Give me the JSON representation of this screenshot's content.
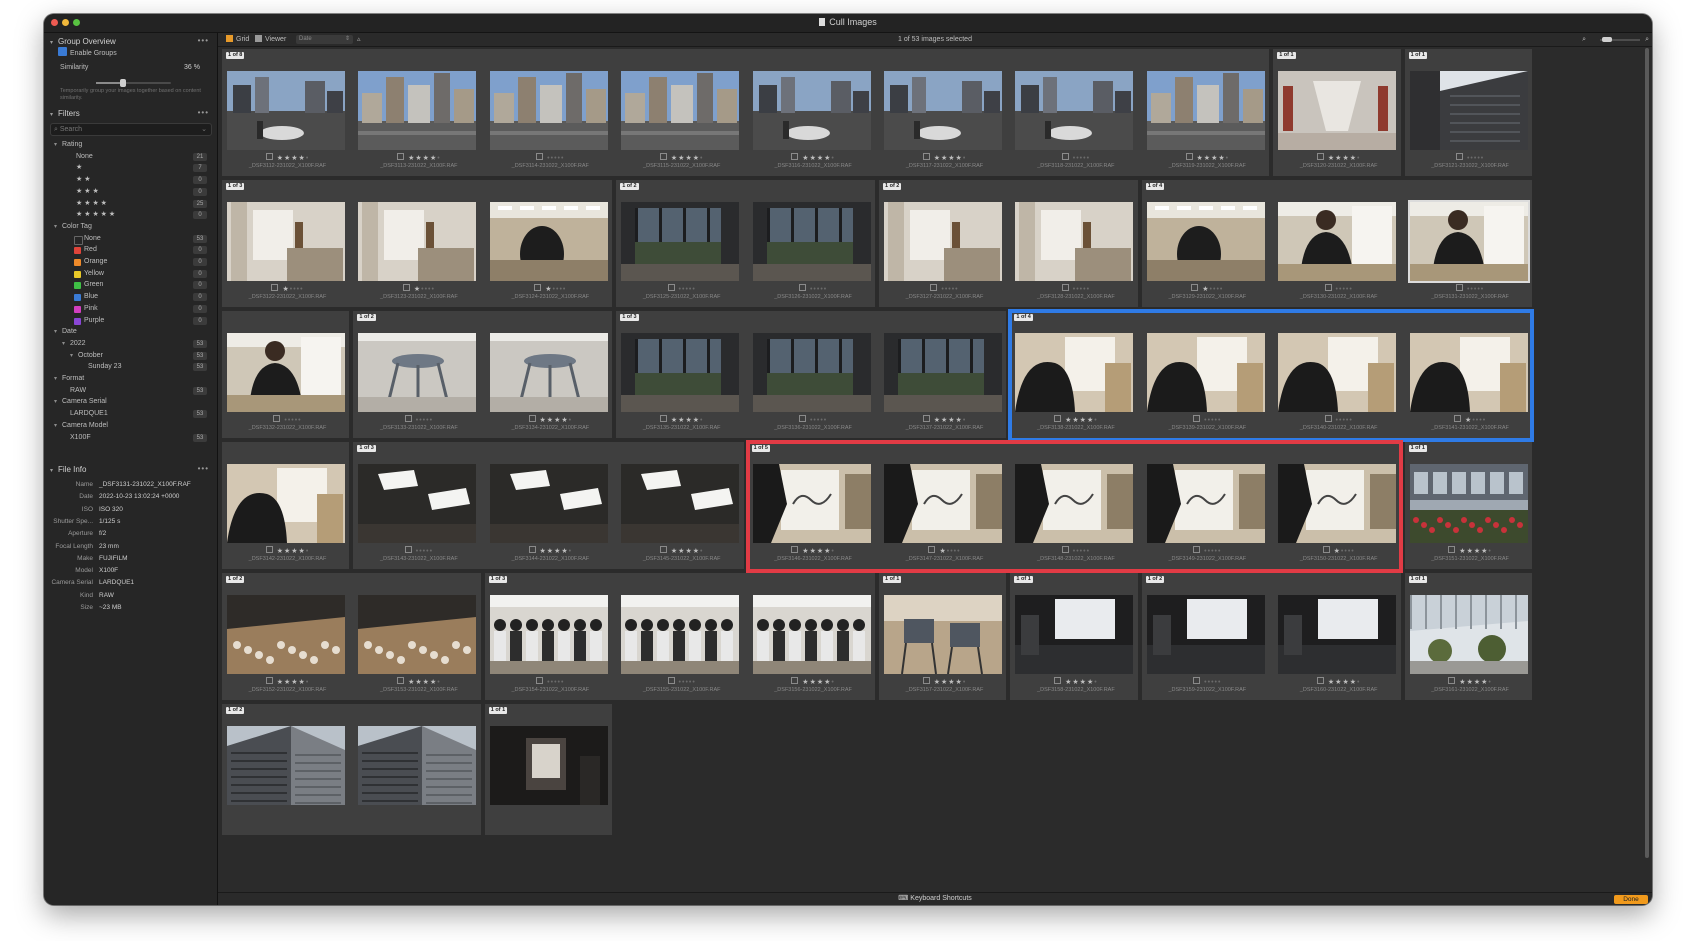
{
  "window": {
    "title": "Cull Images"
  },
  "sidebar": {
    "group_overview": {
      "title": "Group Overview",
      "enable_label": "Enable Groups",
      "similarity_label": "Similarity",
      "similarity_value": "36 %",
      "similarity_fraction": 0.36,
      "hint": "Temporarily group your images together based on content similarity."
    },
    "filters": {
      "title": "Filters",
      "search_placeholder": "Search",
      "rating": {
        "title": "Rating",
        "rows": [
          {
            "label": "None",
            "count": "21"
          },
          {
            "label": "★",
            "count": "7"
          },
          {
            "label": "★ ★",
            "count": "0"
          },
          {
            "label": "★ ★ ★",
            "count": "0"
          },
          {
            "label": "★ ★ ★ ★",
            "count": "25"
          },
          {
            "label": "★ ★ ★ ★ ★",
            "count": "0"
          }
        ]
      },
      "color_tag": {
        "title": "Color Tag",
        "rows": [
          {
            "label": "None",
            "count": "53",
            "color": "#262626"
          },
          {
            "label": "Red",
            "count": "0",
            "color": "#e0443a"
          },
          {
            "label": "Orange",
            "count": "0",
            "color": "#ef8a2a"
          },
          {
            "label": "Yellow",
            "count": "0",
            "color": "#e9c928"
          },
          {
            "label": "Green",
            "count": "0",
            "color": "#3fbf45"
          },
          {
            "label": "Blue",
            "count": "0",
            "color": "#3a7bd5"
          },
          {
            "label": "Pink",
            "count": "0",
            "color": "#d13fc0"
          },
          {
            "label": "Purple",
            "count": "0",
            "color": "#8a46d6"
          }
        ]
      },
      "date": {
        "title": "Date",
        "year": "2022",
        "year_count": "53",
        "month": "October",
        "month_count": "53",
        "day": "Sunday 23",
        "day_count": "53"
      },
      "format": {
        "title": "Format",
        "value": "RAW",
        "count": "53"
      },
      "camera_serial": {
        "title": "Camera Serial",
        "value": "LARDQUE1",
        "count": "53"
      },
      "camera_model": {
        "title": "Camera Model",
        "value": "X100F",
        "count": "53"
      }
    },
    "file_info": {
      "title": "File Info",
      "fields": [
        {
          "key": "Name",
          "value": "_DSF3131-231022_X100F.RAF"
        },
        {
          "key": "Date",
          "value": "2022-10-23 13:02:24 +0000"
        },
        {
          "key": "ISO",
          "value": "ISO 320"
        },
        {
          "key": "Shutter Spe...",
          "value": "1/125 s"
        },
        {
          "key": "Aperture",
          "value": "f/2"
        },
        {
          "key": "Focal Length",
          "value": "23 mm"
        },
        {
          "key": "Make",
          "value": "FUJIFILM"
        },
        {
          "key": "Model",
          "value": "X100F"
        },
        {
          "key": "Camera Serial",
          "value": "LARDQUE1"
        },
        {
          "key": "Kind",
          "value": "RAW"
        },
        {
          "key": "Size",
          "value": "~23 MB"
        }
      ]
    }
  },
  "toolbar": {
    "grid_label": "Grid",
    "viewer_label": "Viewer",
    "sort_value": "Date",
    "selection_status": "1 of 53 images selected"
  },
  "grid": {
    "groups": [
      {
        "badge": "1 of 8",
        "row": 0,
        "start": 0,
        "count": 8
      },
      {
        "badge": "1 of 1",
        "row": 0,
        "start": 8,
        "count": 1
      },
      {
        "badge": "1 of 1",
        "row": 0,
        "start": 9,
        "count": 1
      },
      {
        "badge": "1 of 3",
        "row": 1,
        "start": 0,
        "count": 3
      },
      {
        "badge": "1 of 2",
        "row": 1,
        "start": 3,
        "count": 2
      },
      {
        "badge": "1 of 2",
        "row": 1,
        "start": 5,
        "count": 2
      },
      {
        "badge": "1 of 4",
        "row": 1,
        "start": 7,
        "count": 3
      },
      {
        "badge": "",
        "row": 2,
        "start": 0,
        "count": 1
      },
      {
        "badge": "1 of 2",
        "row": 2,
        "start": 1,
        "count": 2
      },
      {
        "badge": "1 of 3",
        "row": 2,
        "start": 3,
        "count": 3
      },
      {
        "badge": "1 of 4",
        "row": 2,
        "start": 6,
        "count": 4
      },
      {
        "badge": "",
        "row": 3,
        "start": 0,
        "count": 1
      },
      {
        "badge": "1 of 3",
        "row": 3,
        "start": 1,
        "count": 3
      },
      {
        "badge": "1 of 5",
        "row": 3,
        "start": 4,
        "count": 5
      },
      {
        "badge": "1 of 1",
        "row": 3,
        "start": 9,
        "count": 1
      },
      {
        "badge": "1 of 2",
        "row": 4,
        "start": 0,
        "count": 2
      },
      {
        "badge": "1 of 3",
        "row": 4,
        "start": 2,
        "count": 3
      },
      {
        "badge": "1 of 1",
        "row": 4,
        "start": 5,
        "count": 1
      },
      {
        "badge": "1 of 1",
        "row": 4,
        "start": 6,
        "count": 1
      },
      {
        "badge": "1 of 2",
        "row": 4,
        "start": 7,
        "count": 2
      },
      {
        "badge": "1 of 1",
        "row": 4,
        "start": 9,
        "count": 1
      },
      {
        "badge": "1 of 2",
        "row": 5,
        "start": 0,
        "count": 2
      },
      {
        "badge": "1 of 1",
        "row": 5,
        "start": 2,
        "count": 1
      }
    ],
    "images": [
      {
        "row": 0,
        "col": 0,
        "name": "_DSF3112-231022_X100F.RAF",
        "rating": 4,
        "scene": "street"
      },
      {
        "row": 0,
        "col": 1,
        "name": "_DSF3113-231022_X100F.RAF",
        "rating": 4,
        "scene": "city"
      },
      {
        "row": 0,
        "col": 2,
        "name": "_DSF3114-231022_X100F.RAF",
        "rating": 0,
        "scene": "city"
      },
      {
        "row": 0,
        "col": 3,
        "name": "_DSF3115-231022_X100F.RAF",
        "rating": 4,
        "scene": "city"
      },
      {
        "row": 0,
        "col": 4,
        "name": "_DSF3116-231022_X100F.RAF",
        "rating": 4,
        "scene": "street"
      },
      {
        "row": 0,
        "col": 5,
        "name": "_DSF3117-231022_X100F.RAF",
        "rating": 4,
        "scene": "street"
      },
      {
        "row": 0,
        "col": 6,
        "name": "_DSF3118-231022_X100F.RAF",
        "rating": 0,
        "scene": "street"
      },
      {
        "row": 0,
        "col": 7,
        "name": "_DSF3119-231022_X100F.RAF",
        "rating": 4,
        "scene": "city"
      },
      {
        "row": 0,
        "col": 8,
        "name": "_DSF3120-231022_X100F.RAF",
        "rating": 4,
        "scene": "hall"
      },
      {
        "row": 0,
        "col": 9,
        "name": "_DSF3121-231022_X100F.RAF",
        "rating": 0,
        "scene": "building"
      },
      {
        "row": 1,
        "col": 0,
        "name": "_DSF3122-231022_X100F.RAF",
        "rating": 1,
        "scene": "easel"
      },
      {
        "row": 1,
        "col": 1,
        "name": "_DSF3123-231022_X100F.RAF",
        "rating": 1,
        "scene": "easel"
      },
      {
        "row": 1,
        "col": 2,
        "name": "_DSF3124-231022_X100F.RAF",
        "rating": 1,
        "scene": "studio"
      },
      {
        "row": 1,
        "col": 3,
        "name": "_DSF3125-231022_X100F.RAF",
        "rating": 0,
        "scene": "window"
      },
      {
        "row": 1,
        "col": 4,
        "name": "_DSF3126-231022_X100F.RAF",
        "rating": 0,
        "scene": "window"
      },
      {
        "row": 1,
        "col": 5,
        "name": "_DSF3127-231022_X100F.RAF",
        "rating": 0,
        "scene": "easel"
      },
      {
        "row": 1,
        "col": 6,
        "name": "_DSF3128-231022_X100F.RAF",
        "rating": 0,
        "scene": "easel"
      },
      {
        "row": 1,
        "col": 7,
        "name": "_DSF3129-231022_X100F.RAF",
        "rating": 1,
        "scene": "studio"
      },
      {
        "row": 1,
        "col": 8,
        "name": "_DSF3130-231022_X100F.RAF",
        "rating": 0,
        "scene": "person"
      },
      {
        "row": 1,
        "col": 9,
        "name": "_DSF3131-231022_X100F.RAF",
        "rating": 0,
        "scene": "person",
        "selected": true
      },
      {
        "row": 2,
        "col": 0,
        "name": "_DSF3132-231022_X100F.RAF",
        "rating": 0,
        "scene": "person"
      },
      {
        "row": 2,
        "col": 1,
        "name": "_DSF3133-231022_X100F.RAF",
        "rating": 0,
        "scene": "stool"
      },
      {
        "row": 2,
        "col": 2,
        "name": "_DSF3134-231022_X100F.RAF",
        "rating": 4,
        "scene": "stool"
      },
      {
        "row": 2,
        "col": 3,
        "name": "_DSF3135-231022_X100F.RAF",
        "rating": 4,
        "scene": "window"
      },
      {
        "row": 2,
        "col": 4,
        "name": "_DSF3136-231022_X100F.RAF",
        "rating": 0,
        "scene": "window"
      },
      {
        "row": 2,
        "col": 5,
        "name": "_DSF3137-231022_X100F.RAF",
        "rating": 4,
        "scene": "window"
      },
      {
        "row": 2,
        "col": 6,
        "name": "_DSF3138-231022_X100F.RAF",
        "rating": 4,
        "scene": "drawing"
      },
      {
        "row": 2,
        "col": 7,
        "name": "_DSF3139-231022_X100F.RAF",
        "rating": 0,
        "scene": "drawing"
      },
      {
        "row": 2,
        "col": 8,
        "name": "_DSF3140-231022_X100F.RAF",
        "rating": 0,
        "scene": "drawing"
      },
      {
        "row": 2,
        "col": 9,
        "name": "_DSF3141-231022_X100F.RAF",
        "rating": 1,
        "scene": "drawing"
      },
      {
        "row": 3,
        "col": 0,
        "name": "_DSF3142-231022_X100F.RAF",
        "rating": 4,
        "scene": "drawing"
      },
      {
        "row": 3,
        "col": 1,
        "name": "_DSF3143-231022_X100F.RAF",
        "rating": 0,
        "scene": "ceiling"
      },
      {
        "row": 3,
        "col": 2,
        "name": "_DSF3144-231022_X100F.RAF",
        "rating": 4,
        "scene": "ceiling"
      },
      {
        "row": 3,
        "col": 3,
        "name": "_DSF3145-231022_X100F.RAF",
        "rating": 4,
        "scene": "ceiling"
      },
      {
        "row": 3,
        "col": 4,
        "name": "_DSF3146-231022_X100F.RAF",
        "rating": 4,
        "scene": "sketch"
      },
      {
        "row": 3,
        "col": 5,
        "name": "_DSF3147-231022_X100F.RAF",
        "rating": 1,
        "scene": "sketch"
      },
      {
        "row": 3,
        "col": 6,
        "name": "_DSF3148-231022_X100F.RAF",
        "rating": 0,
        "scene": "sketch"
      },
      {
        "row": 3,
        "col": 7,
        "name": "_DSF3149-231022_X100F.RAF",
        "rating": 0,
        "scene": "sketch"
      },
      {
        "row": 3,
        "col": 8,
        "name": "_DSF3150-231022_X100F.RAF",
        "rating": 1,
        "scene": "sketch"
      },
      {
        "row": 3,
        "col": 9,
        "name": "_DSF3151-231022_X100F.RAF",
        "rating": 4,
        "scene": "flowers"
      },
      {
        "row": 4,
        "col": 0,
        "name": "_DSF3152-231022_X100F.RAF",
        "rating": 4,
        "scene": "table"
      },
      {
        "row": 4,
        "col": 1,
        "name": "_DSF3153-231022_X100F.RAF",
        "rating": 4,
        "scene": "table"
      },
      {
        "row": 4,
        "col": 2,
        "name": "_DSF3154-231022_X100F.RAF",
        "rating": 0,
        "scene": "crowd"
      },
      {
        "row": 4,
        "col": 3,
        "name": "_DSF3155-231022_X100F.RAF",
        "rating": 0,
        "scene": "crowd"
      },
      {
        "row": 4,
        "col": 4,
        "name": "_DSF3156-231022_X100F.RAF",
        "rating": 4,
        "scene": "crowd"
      },
      {
        "row": 4,
        "col": 5,
        "name": "_DSF3157-231022_X100F.RAF",
        "rating": 4,
        "scene": "chairs"
      },
      {
        "row": 4,
        "col": 6,
        "name": "_DSF3158-231022_X100F.RAF",
        "rating": 4,
        "scene": "dark"
      },
      {
        "row": 4,
        "col": 7,
        "name": "_DSF3159-231022_X100F.RAF",
        "rating": 0,
        "scene": "dark"
      },
      {
        "row": 4,
        "col": 8,
        "name": "_DSF3160-231022_X100F.RAF",
        "rating": 4,
        "scene": "dark"
      },
      {
        "row": 4,
        "col": 9,
        "name": "_DSF3161-231022_X100F.RAF",
        "rating": 4,
        "scene": "atrium"
      },
      {
        "row": 5,
        "col": 0,
        "name": "",
        "rating": -1,
        "scene": "tower"
      },
      {
        "row": 5,
        "col": 1,
        "name": "",
        "rating": -1,
        "scene": "tower"
      },
      {
        "row": 5,
        "col": 2,
        "name": "",
        "rating": -1,
        "scene": "doorway"
      }
    ]
  },
  "highlights": [
    {
      "color": "#2f7be6",
      "row": 2,
      "start": 6,
      "count": 4
    },
    {
      "color": "#e23b45",
      "row": 3,
      "start": 4,
      "count": 5
    }
  ],
  "bottom": {
    "shortcuts_label": "Keyboard Shortcuts",
    "done_label": "Done"
  }
}
